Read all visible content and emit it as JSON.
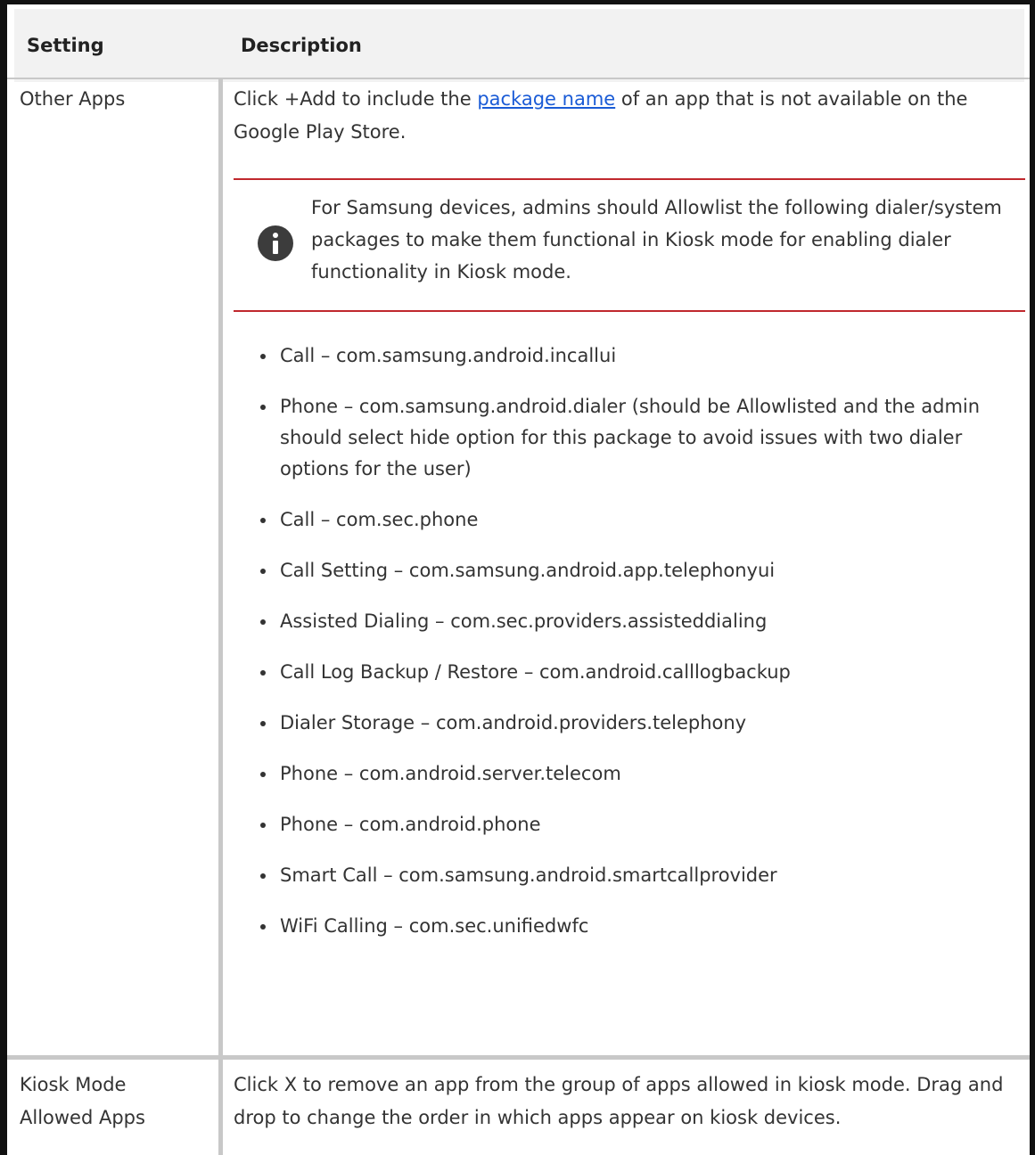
{
  "table": {
    "headers": {
      "setting": "Setting",
      "description": "Description"
    },
    "rows": [
      {
        "setting": "Other Apps",
        "description": {
          "before_link": "Click +Add to include the ",
          "link": "package name",
          "after_link": " of an app that is not available on the Google Play Store."
        },
        "note": "For Samsung devices, admins should Allowlist the following dialer/system packages to make them functional in Kiosk mode for enabling dialer functionality in Kiosk mode.",
        "packages": [
          "Call – com.samsung.android.incallui",
          "Phone – com.samsung.android.dialer (should be Allowlisted and the admin should select hide option for this package to avoid issues with two dialer options for the user)",
          "Call – com.sec.phone",
          "Call Setting – com.samsung.android.app.telephonyui",
          "Assisted Dialing – com.sec.providers.assisteddialing",
          "Call Log Backup / Restore – com.android.calllogbackup",
          "Dialer Storage – com.android.providers.telephony",
          "Phone – com.android.server.telecom",
          "Phone – com.android.phone",
          "Smart Call – com.samsung.android.smartcallprovider",
          "WiFi Calling – com.sec.unifiedwfc"
        ]
      },
      {
        "setting_line1": "Kiosk Mode",
        "setting_line2": "Allowed Apps",
        "description": "Click X to remove an app from the group of apps allowed in kiosk mode. Drag and drop to change the order in which apps appear on kiosk devices."
      }
    ]
  },
  "colors": {
    "header_bg": "#f2f2f2",
    "note_rule": "#c0282d",
    "link": "#1a5bd6",
    "grid": "#c8c8c8"
  },
  "icons": {
    "note": "info-icon"
  }
}
